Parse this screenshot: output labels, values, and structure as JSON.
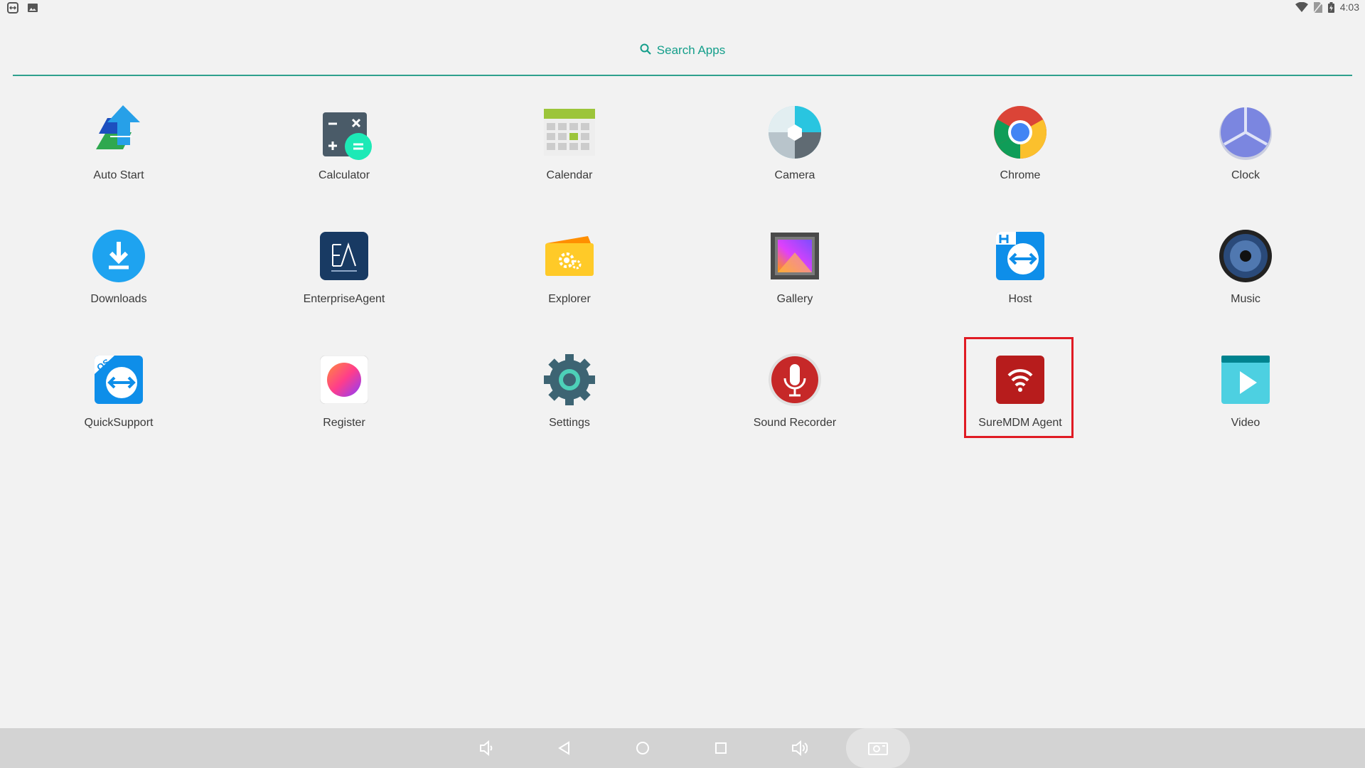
{
  "status_bar": {
    "time": "4:03"
  },
  "search": {
    "label": "Search Apps"
  },
  "apps": [
    {
      "label": "Auto Start"
    },
    {
      "label": "Calculator"
    },
    {
      "label": "Calendar"
    },
    {
      "label": "Camera"
    },
    {
      "label": "Chrome"
    },
    {
      "label": "Clock"
    },
    {
      "label": "Downloads"
    },
    {
      "label": "EnterpriseAgent"
    },
    {
      "label": "Explorer"
    },
    {
      "label": "Gallery"
    },
    {
      "label": "Host"
    },
    {
      "label": "Music"
    },
    {
      "label": "QuickSupport"
    },
    {
      "label": "Register"
    },
    {
      "label": "Settings"
    },
    {
      "label": "Sound Recorder"
    },
    {
      "label": "SureMDM Agent"
    },
    {
      "label": "Video"
    }
  ],
  "colors": {
    "accent": "#139e8a",
    "highlight": "#e01b24"
  }
}
